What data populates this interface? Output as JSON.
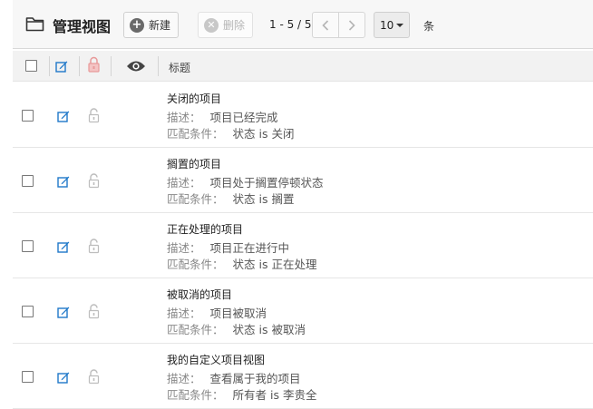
{
  "toolbar": {
    "title": "管理视图",
    "new_label": "新建",
    "delete_label": "删除",
    "pager_range": "1 - 5 / 5",
    "per_page": "10",
    "per_page_unit": "条"
  },
  "table": {
    "title_header": "标题",
    "desc_label": "描述：",
    "cond_label": "匹配条件：",
    "rows": [
      {
        "title": "关闭的项目",
        "desc": "项目已经完成",
        "cond": "状态 is 关闭"
      },
      {
        "title": "搁置的项目",
        "desc": "项目处于搁置停顿状态",
        "cond": "状态 is 搁置"
      },
      {
        "title": "正在处理的项目",
        "desc": "项目正在进行中",
        "cond": "状态 is 正在处理"
      },
      {
        "title": "被取消的项目",
        "desc": "项目被取消",
        "cond": "状态 is 被取消"
      },
      {
        "title": "我的自定义项目视图",
        "desc": "查看属于我的项目",
        "cond": "所有者 is 李贵全"
      }
    ]
  },
  "icons": {
    "toolbar": "folder-icon",
    "header": [
      "edit-icon",
      "lock-icon",
      "eye-icon"
    ],
    "row": [
      "edit-icon",
      "unlock-icon"
    ]
  },
  "colors": {
    "edit": "#1f78c9",
    "lock_header": "#e8a0a0",
    "lock_row": "#bdbdbd"
  }
}
